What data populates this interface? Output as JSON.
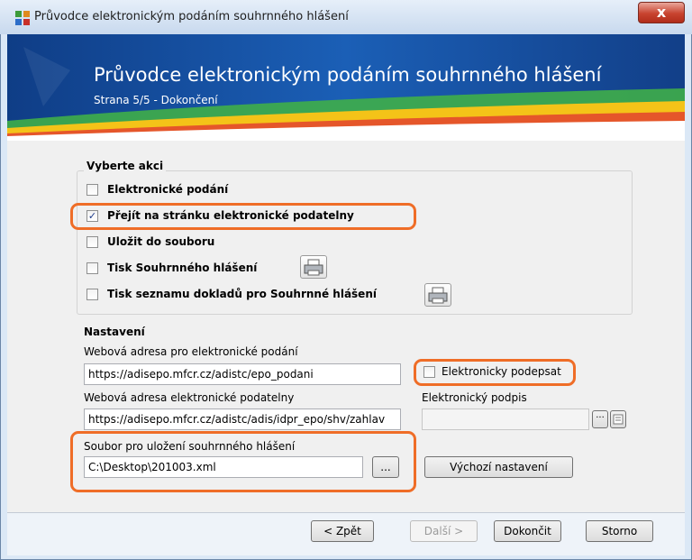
{
  "window": {
    "title": "Průvodce elektronickým podáním souhrnného hlášení",
    "close_glyph": "x"
  },
  "banner": {
    "title": "Průvodce elektronickým podáním souhrnného hlášení",
    "subtitle": "Strana 5/5 - Dokončení"
  },
  "action_group": {
    "title": "Vyberte akci",
    "options": [
      {
        "label": "Elektronické podání",
        "checked": false
      },
      {
        "label": "Přejít na stránku elektronické podatelny",
        "checked": true
      },
      {
        "label": "Uložit do souboru",
        "checked": false
      },
      {
        "label": "Tisk Souhrnného hlášení",
        "checked": false
      },
      {
        "label": "Tisk seznamu dokladů pro Souhrnné hlášení",
        "checked": false
      }
    ]
  },
  "settings": {
    "title": "Nastavení",
    "epo_url_label": "Webová adresa pro elektronické podání",
    "epo_url_value": "https://adisepo.mfcr.cz/adistc/epo_podani",
    "podatelna_url_label": "Webová adresa elektronické podatelny",
    "podatelna_url_value": "https://adisepo.mfcr.cz/adistc/adis/idpr_epo/shv/zahlav",
    "sign_checkbox_label": "Elektronicky podepsat",
    "sign_checked": false,
    "signature_label": "Elektronický podpis",
    "signature_value": "",
    "file_label": "Soubor pro uložení souhrnného hlášení",
    "file_value": "C:\\Desktop\\201003.xml",
    "browse_label": "...",
    "defaults_button": "Výchozí nastavení"
  },
  "footer": {
    "back": "< Zpět",
    "next": "Další >",
    "finish": "Dokončit",
    "cancel": "Storno"
  },
  "colors": {
    "highlight": "#ef6d27",
    "banner": "#1b5fb6"
  }
}
